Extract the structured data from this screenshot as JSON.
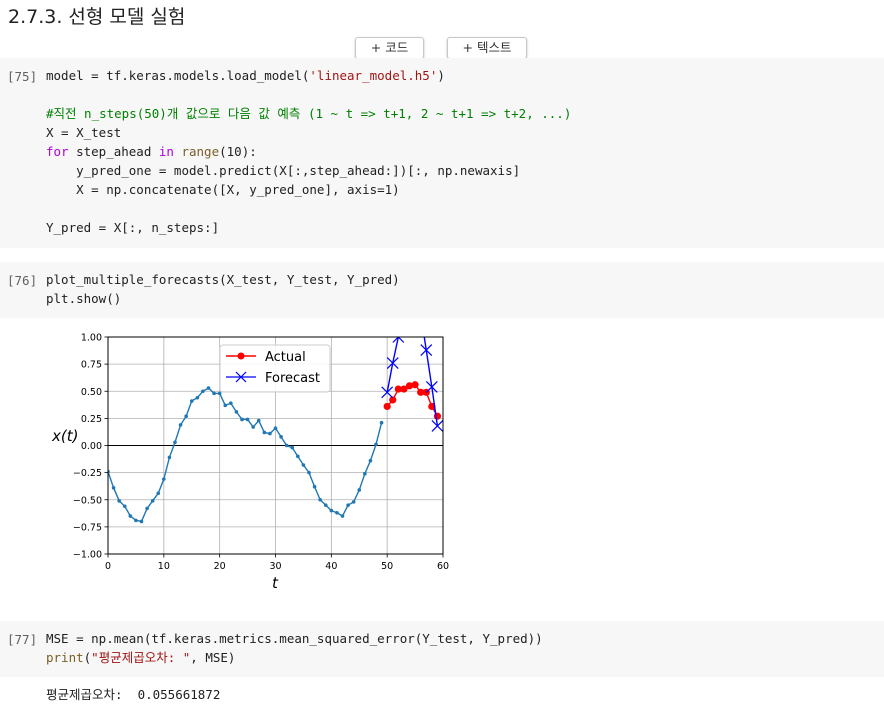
{
  "section_title": "2.7.3. 선형 모델 실험",
  "toolbar": {
    "add_code": "+ 코드",
    "add_text": "+ 텍스트"
  },
  "cells": [
    {
      "prompt": "[75]",
      "lines": [
        [
          {
            "t": "model = tf.keras.models.load_model("
          },
          {
            "t": "'linear_model.h5'",
            "c": "str"
          },
          {
            "t": ")"
          }
        ],
        [],
        [
          {
            "t": "#직전 n_steps(50)개 값으로 다음 값 예측 (1 ~ t => t+1, 2 ~ t+1 => t+2, ...)",
            "c": "cmt"
          }
        ],
        [
          {
            "t": "X = X_test"
          }
        ],
        [
          {
            "t": "for",
            "c": "kw"
          },
          {
            "t": " step_ahead "
          },
          {
            "t": "in",
            "c": "kw"
          },
          {
            "t": " "
          },
          {
            "t": "range",
            "c": "bi"
          },
          {
            "t": "(10):"
          }
        ],
        [
          {
            "t": "    y_pred_one = model.predict(X[:,step_ahead:])[:, np.newaxis]"
          }
        ],
        [
          {
            "t": "    X = np.concatenate([X, y_pred_one], axis=1)"
          }
        ],
        [],
        [
          {
            "t": "Y_pred = X[:, n_steps:]"
          }
        ]
      ]
    },
    {
      "prompt": "[76]",
      "lines": [
        [
          {
            "t": "plot_multiple_forecasts(X_test, Y_test, Y_pred)"
          }
        ],
        [
          {
            "t": "plt.show()"
          }
        ]
      ]
    },
    {
      "prompt": "[77]",
      "lines": [
        [
          {
            "t": "MSE = np.mean(tf.keras.metrics.mean_squared_error(Y_test, Y_pred))"
          }
        ],
        [
          {
            "t": "print",
            "c": "bi"
          },
          {
            "t": "("
          },
          {
            "t": "\"평균제곱오차: \"",
            "c": "str"
          },
          {
            "t": ", MSE)"
          }
        ]
      ]
    }
  ],
  "output_text": "평균제곱오차:  0.055661872",
  "colors": {
    "series": "#1f77b4",
    "actual": "#ff0000",
    "forecast": "#0000ff"
  },
  "chart_data": {
    "type": "line",
    "xlabel": "t",
    "ylabel": "x(t)",
    "xlim": [
      0,
      60
    ],
    "ylim": [
      -1.0,
      1.0
    ],
    "xticks": [
      0,
      10,
      20,
      30,
      40,
      50,
      60
    ],
    "yticks": [
      -1.0,
      -0.75,
      -0.5,
      -0.25,
      0.0,
      0.25,
      0.5,
      0.75,
      1.0
    ],
    "ytick_labels": [
      "−1.00",
      "−0.75",
      "−0.50",
      "−0.25",
      "0.00",
      "0.25",
      "0.50",
      "0.75",
      "1.00"
    ],
    "grid": true,
    "legend_position": "top-center",
    "series": [
      {
        "x": [
          0,
          1,
          2,
          3,
          4,
          5,
          6,
          7,
          8,
          9,
          10,
          11,
          12,
          13,
          14,
          15,
          16,
          17,
          18,
          19,
          20,
          21,
          22,
          23,
          24,
          25,
          26,
          27,
          28,
          29,
          30,
          31,
          32,
          33,
          34,
          35,
          36,
          37,
          38,
          39,
          40,
          41,
          42,
          43,
          44,
          45,
          46,
          47,
          48,
          49
        ],
        "y": [
          -0.24,
          -0.39,
          -0.51,
          -0.56,
          -0.65,
          -0.69,
          -0.7,
          -0.58,
          -0.51,
          -0.44,
          -0.31,
          -0.11,
          0.03,
          0.19,
          0.27,
          0.41,
          0.44,
          0.5,
          0.53,
          0.48,
          0.48,
          0.37,
          0.39,
          0.31,
          0.24,
          0.24,
          0.17,
          0.23,
          0.12,
          0.11,
          0.16,
          0.08,
          0.0,
          -0.02,
          -0.1,
          -0.18,
          -0.25,
          -0.38,
          -0.5,
          -0.55,
          -0.6,
          -0.62,
          -0.65,
          -0.55,
          -0.52,
          -0.41,
          -0.26,
          -0.14,
          0.01,
          0.21
        ]
      },
      {
        "name": "Actual",
        "x": [
          50,
          51,
          52,
          53,
          54,
          55,
          56,
          57,
          58,
          59
        ],
        "y": [
          0.36,
          0.42,
          0.52,
          0.52,
          0.55,
          0.56,
          0.49,
          0.49,
          0.36,
          0.27
        ]
      },
      {
        "name": "Forecast",
        "x": [
          50,
          51,
          52,
          53,
          54,
          55,
          56,
          57,
          58,
          59
        ],
        "y": [
          0.49,
          0.76,
          1.0,
          1.18,
          1.28,
          1.3,
          1.22,
          0.88,
          0.54,
          0.18
        ]
      }
    ]
  }
}
